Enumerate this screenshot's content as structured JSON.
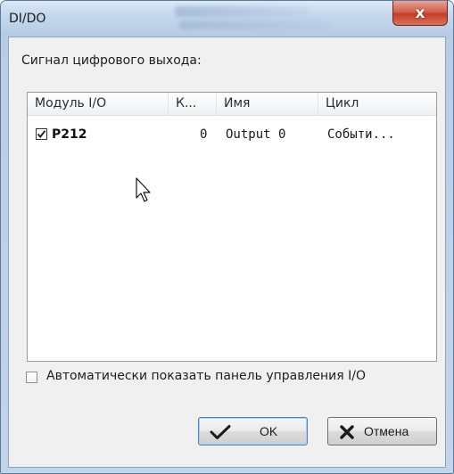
{
  "window": {
    "title": "DI/DO",
    "close_label": "x"
  },
  "group": {
    "label": "Сигнал цифрового выхода:"
  },
  "table": {
    "columns": [
      "Модуль I/O",
      "К...",
      "Имя",
      "Цикл"
    ],
    "rows": [
      {
        "checked": true,
        "module": "P212",
        "k": "0",
        "name": "Output 0",
        "cycle": "Событи..."
      }
    ]
  },
  "auto_show": {
    "checked": false,
    "label": "Автоматически показать панель управления I/O"
  },
  "buttons": {
    "ok_label": "OK",
    "cancel_label": "Отмена"
  },
  "icons": {
    "ok": "checkmark-icon",
    "cancel": "x-icon",
    "cursor": "mouse-pointer-icon"
  }
}
